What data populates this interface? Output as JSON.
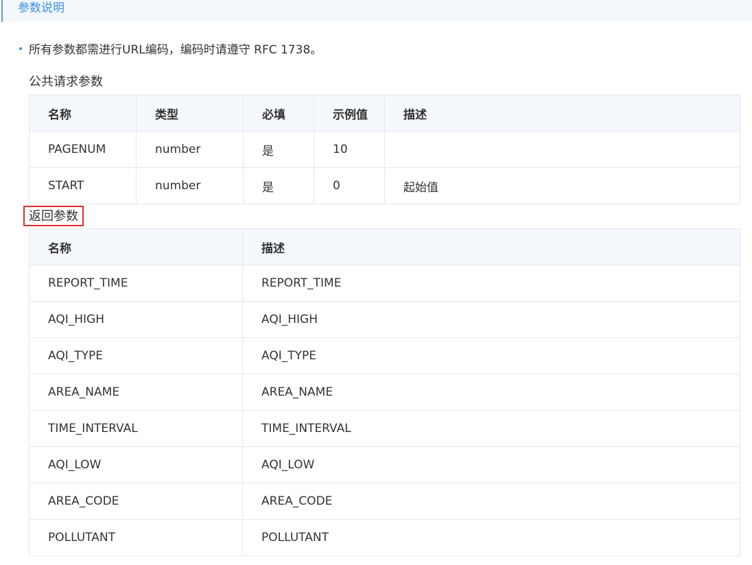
{
  "section": {
    "title": "参数说明"
  },
  "note": {
    "text": "所有参数都需进行URL编码，编码时请遵守 RFC 1738。"
  },
  "public_params": {
    "label": "公共请求参数",
    "headers": [
      "名称",
      "类型",
      "必填",
      "示例值",
      "描述"
    ],
    "rows": [
      [
        "PAGENUM",
        "number",
        "是",
        "10",
        ""
      ],
      [
        "START",
        "number",
        "是",
        "0",
        "起始值"
      ]
    ]
  },
  "return_params": {
    "label": "返回参数",
    "headers": [
      "名称",
      "描述"
    ],
    "rows": [
      [
        "REPORT_TIME",
        "REPORT_TIME"
      ],
      [
        "AQI_HIGH",
        "AQI_HIGH"
      ],
      [
        "AQI_TYPE",
        "AQI_TYPE"
      ],
      [
        "AREA_NAME",
        "AREA_NAME"
      ],
      [
        "TIME_INTERVAL",
        "TIME_INTERVAL"
      ],
      [
        "AQI_LOW",
        "AQI_LOW"
      ],
      [
        "AREA_CODE",
        "AREA_CODE"
      ],
      [
        "POLLUTANT",
        "POLLUTANT"
      ]
    ]
  },
  "colors": {
    "accent": "#3b8fe0",
    "highlight_border": "#e02b2b",
    "header_bg": "#f5f8fc",
    "border": "#e4e7ec"
  }
}
